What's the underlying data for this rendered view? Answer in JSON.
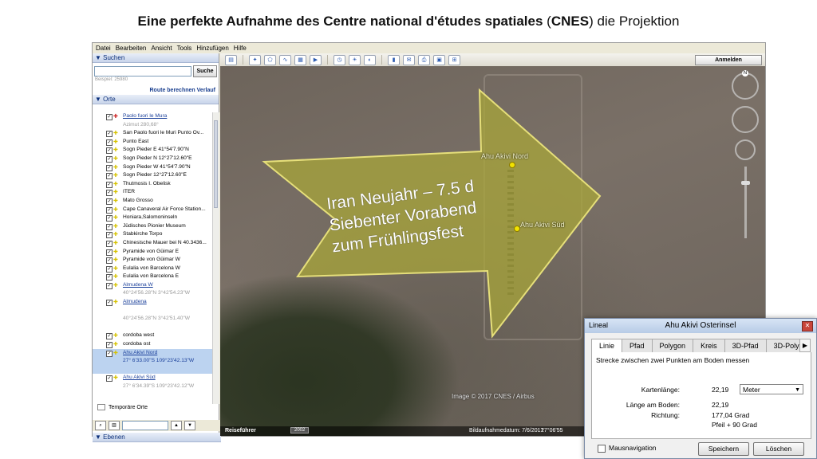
{
  "slide": {
    "title_bold_1": "Eine perfekte Aufnahme des Centre national d'études spatiales",
    "title_paren_open": " (",
    "title_bold_2": "CNES",
    "title_rest": ") die Projektion"
  },
  "menu": [
    "Datei",
    "Bearbeiten",
    "Ansicht",
    "Tools",
    "Hinzufügen",
    "Hilfe"
  ],
  "toolbar": {
    "signin_label": "Anmelden"
  },
  "search": {
    "header": "▼ Suchen",
    "button": "Suche",
    "hint": "Beispiel: 25980",
    "route_label": "Route berechnen",
    "history_label": "Verlauf"
  },
  "places": {
    "header": "▼ Orte",
    "items": [
      {
        "label": "Paolo fuori le Mura",
        "type": "link",
        "pin": "red"
      },
      {
        "label": "Azimut 280,68°",
        "type": "sub"
      },
      {
        "label": "San Paolo fuori le Muri Punto Ov...",
        "type": "item"
      },
      {
        "label": "Punto East",
        "type": "item"
      },
      {
        "label": "Sogn Pieder E 41°54'7.90\"N",
        "type": "item"
      },
      {
        "label": "Sogn Pieder N 12°27'12.60\"E",
        "type": "item"
      },
      {
        "label": "Sogn Pieder W  41°54'7.90\"N",
        "type": "item"
      },
      {
        "label": "Sogn Pieder  12°27'12.60\"E",
        "type": "item"
      },
      {
        "label": "Thutmosis I. Obelisk",
        "type": "item"
      },
      {
        "label": "ITER",
        "type": "item"
      },
      {
        "label": "Mato Grosso",
        "type": "item"
      },
      {
        "label": "Cape Canaveral Air Force Station...",
        "type": "item"
      },
      {
        "label": "Honiara,Salomoninseln",
        "type": "item"
      },
      {
        "label": "Jüdisches Pionier Museum",
        "type": "item"
      },
      {
        "label": "Stabkirche Torpo",
        "type": "item"
      },
      {
        "label": "Chinesische Mauer bei N 40.3436...",
        "type": "item"
      },
      {
        "label": "Pyramide von Güimar E",
        "type": "item"
      },
      {
        "label": "Pyramide von Güimar W",
        "type": "item"
      },
      {
        "label": "Eulalia von Barcelona W",
        "type": "item"
      },
      {
        "label": "Eulalia von Barcelona E",
        "type": "item"
      },
      {
        "label": "Almudena W",
        "type": "link"
      },
      {
        "label": "40°24'56.28\"N 3°42'54.23\"W",
        "type": "sub"
      },
      {
        "label": "Almudena",
        "type": "link"
      },
      {
        "label": "",
        "type": "blank"
      },
      {
        "label": "40°24'56.28\"N 3°42'51.40\"W",
        "type": "sub"
      },
      {
        "label": "",
        "type": "blank"
      },
      {
        "label": "cordoba west",
        "type": "item"
      },
      {
        "label": "cordoba ost",
        "type": "item"
      },
      {
        "label": "Ahu Akivi Nord",
        "type": "link",
        "selected": true
      },
      {
        "label": "27° 6'33.00\"S 109°23'42.13\"W",
        "type": "sub",
        "selected": true
      },
      {
        "label": "",
        "type": "blank",
        "selected": true
      },
      {
        "label": "Ahu Akivi Süd",
        "type": "link"
      },
      {
        "label": "27° 6'34.39\"S 109°23'42.12\"W",
        "type": "sub"
      }
    ],
    "temp_label": "Temporäre Orte"
  },
  "layers": {
    "header": "▼ Ebenen"
  },
  "map": {
    "label_nord": "Ahu Akivi Nord",
    "label_sued": "Ahu Akivi Süd",
    "copyright": "Image © 2017 CNES / Airbus",
    "tour_label": "Reiseführer",
    "year": "2002",
    "date_label": "Bildaufnahmedatum: 7/6/2017",
    "coord_label": "27°06'55",
    "compass_n": "N",
    "arrow_fill": "#a8a53a"
  },
  "overlay": {
    "line1": "Iran Neujahr – 7.5 d",
    "line2": "Siebenter Vorabend",
    "line3": "zum Frühlingsfest"
  },
  "ruler": {
    "app_label": "Lineal",
    "title": "Ahu Akivi Osterinsel",
    "tabs": [
      "Linie",
      "Pfad",
      "Polygon",
      "Kreis",
      "3D-Pfad",
      "3D-Poly"
    ],
    "description": "Strecke zwischen zwei Punkten am Boden messen",
    "map_length_label": "Kartenlänge:",
    "map_length_value": "22,19",
    "unit": "Meter",
    "ground_length_label": "Länge am Boden:",
    "ground_length_value": "22,19",
    "heading_label": "Richtung:",
    "heading_value": "177,04 Grad",
    "heading_extra": "Pfeil + 90 Grad",
    "mouse_nav_label": "Mausnavigation",
    "save_button": "Speichern",
    "clear_button": "Löschen"
  }
}
